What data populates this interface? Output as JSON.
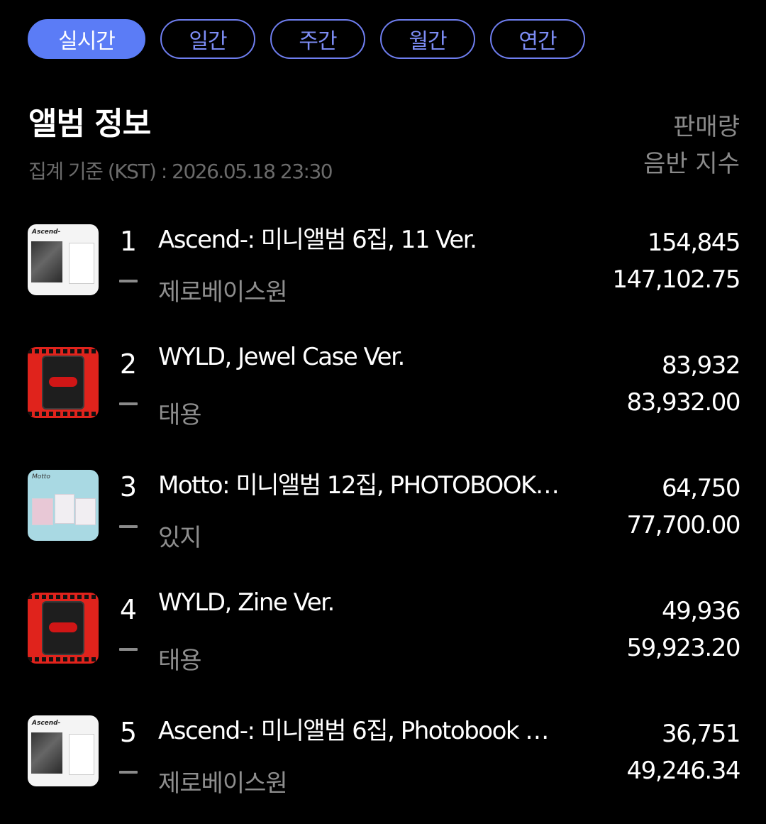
{
  "tabs": [
    {
      "label": "실시간",
      "active": true
    },
    {
      "label": "일간",
      "active": false
    },
    {
      "label": "주간",
      "active": false
    },
    {
      "label": "월간",
      "active": false
    },
    {
      "label": "연간",
      "active": false
    }
  ],
  "header": {
    "title": "앨범 정보",
    "basis": "집계 기준 (KST) : 2026.05.18 23:30",
    "col_sales": "판매량",
    "col_index": "음반 지수"
  },
  "albums": [
    {
      "rank": "1",
      "title": "Ascend-: 미니앨범 6집, 11 Ver.",
      "artist": "제로베이스원",
      "sales": "154,845",
      "index": "147,102.75",
      "cover_logo": "Ascend-"
    },
    {
      "rank": "2",
      "title": "WYLD, Jewel Case Ver.",
      "artist": "태용",
      "sales": "83,932",
      "index": "83,932.00"
    },
    {
      "rank": "3",
      "title": "Motto: 미니앨범 12집, PHOTOBOOK…",
      "artist": "있지",
      "sales": "64,750",
      "index": "77,700.00",
      "cover_logo": "Motto"
    },
    {
      "rank": "4",
      "title": "WYLD, Zine Ver.",
      "artist": "태용",
      "sales": "49,936",
      "index": "59,923.20"
    },
    {
      "rank": "5",
      "title": "Ascend-: 미니앨범 6집, Photobook …",
      "artist": "제로베이스원",
      "sales": "36,751",
      "index": "49,246.34",
      "cover_logo": "Ascend-"
    }
  ],
  "colors": {
    "accent": "#5b7cf6",
    "background": "#000000",
    "muted_text": "#8e8e8e"
  }
}
